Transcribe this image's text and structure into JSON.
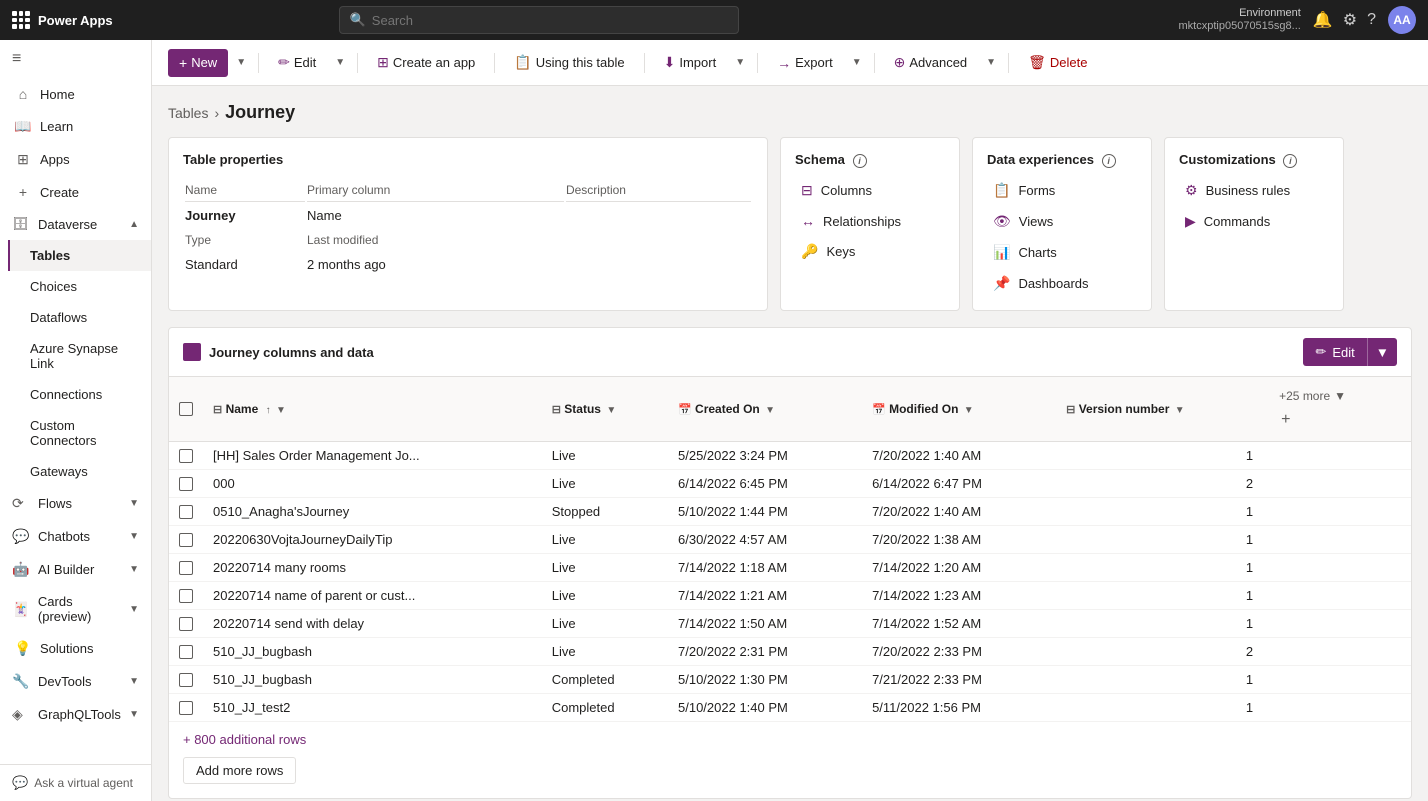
{
  "app": {
    "title": "Power Apps",
    "search_placeholder": "Search"
  },
  "env": {
    "label": "Environment",
    "name": "mktcxptip05070515sg8..."
  },
  "avatar": "AA",
  "sidebar": {
    "collapse_icon": "≡",
    "items": [
      {
        "id": "home",
        "label": "Home",
        "icon": "⌂"
      },
      {
        "id": "learn",
        "label": "Learn",
        "icon": "📖"
      },
      {
        "id": "apps",
        "label": "Apps",
        "icon": "⊞"
      },
      {
        "id": "create",
        "label": "Create",
        "icon": "+"
      },
      {
        "id": "dataverse",
        "label": "Dataverse",
        "icon": "🗄",
        "expandable": true,
        "expanded": true
      },
      {
        "id": "tables",
        "label": "Tables",
        "icon": ""
      },
      {
        "id": "choices",
        "label": "Choices",
        "icon": ""
      },
      {
        "id": "dataflows",
        "label": "Dataflows",
        "icon": ""
      },
      {
        "id": "azure-synapse",
        "label": "Azure Synapse Link",
        "icon": ""
      },
      {
        "id": "connections",
        "label": "Connections",
        "icon": ""
      },
      {
        "id": "custom-connectors",
        "label": "Custom Connectors",
        "icon": ""
      },
      {
        "id": "gateways",
        "label": "Gateways",
        "icon": ""
      },
      {
        "id": "flows",
        "label": "Flows",
        "icon": "⟳",
        "expandable": true
      },
      {
        "id": "chatbots",
        "label": "Chatbots",
        "icon": "💬",
        "expandable": true
      },
      {
        "id": "ai-builder",
        "label": "AI Builder",
        "icon": "🤖",
        "expandable": true
      },
      {
        "id": "cards",
        "label": "Cards (preview)",
        "icon": "🃏",
        "expandable": true
      },
      {
        "id": "solutions",
        "label": "Solutions",
        "icon": "💡"
      },
      {
        "id": "devtools",
        "label": "DevTools",
        "icon": "🔧",
        "expandable": true
      },
      {
        "id": "graphql-tools",
        "label": "GraphQLTools",
        "icon": "◈",
        "expandable": true
      }
    ],
    "virtual_agent": "Ask a virtual agent"
  },
  "toolbar": {
    "new_label": "New",
    "edit_label": "Edit",
    "create_app_label": "Create an app",
    "using_table_label": "Using this table",
    "import_label": "Import",
    "export_label": "Export",
    "advanced_label": "Advanced",
    "delete_label": "Delete"
  },
  "breadcrumb": {
    "tables_label": "Tables",
    "current": "Journey"
  },
  "table_properties": {
    "card_title": "Table properties",
    "cols": [
      "Name",
      "Primary column",
      "Description"
    ],
    "rows": [
      {
        "name": "Journey",
        "primary_column": "Name",
        "description": ""
      },
      {
        "type_label": "Type",
        "last_modified_label": "Last modified",
        "description": ""
      },
      {
        "name": "Standard",
        "primary_column": "2 months ago",
        "description": ""
      }
    ],
    "name_label": "Name",
    "type_label": "Type",
    "name_value": "Journey",
    "type_value": "Standard",
    "primary_col_label": "Primary column",
    "primary_col_value": "Name",
    "last_modified_label": "Last modified",
    "last_modified_value": "2 months ago",
    "description_label": "Description"
  },
  "schema": {
    "card_title": "Schema",
    "info": "i",
    "items": [
      {
        "id": "columns",
        "label": "Columns",
        "icon": "⊟"
      },
      {
        "id": "relationships",
        "label": "Relationships",
        "icon": "↔"
      },
      {
        "id": "keys",
        "label": "Keys",
        "icon": "🔑"
      }
    ]
  },
  "data_experiences": {
    "card_title": "Data experiences",
    "info": "i",
    "items": [
      {
        "id": "forms",
        "label": "Forms",
        "icon": "📋"
      },
      {
        "id": "views",
        "label": "Views",
        "icon": "👁"
      },
      {
        "id": "charts",
        "label": "Charts",
        "icon": "📊"
      },
      {
        "id": "dashboards",
        "label": "Dashboards",
        "icon": "📌"
      }
    ]
  },
  "customizations": {
    "card_title": "Customizations",
    "info": "i",
    "items": [
      {
        "id": "business-rules",
        "label": "Business rules",
        "icon": "⚙"
      },
      {
        "id": "commands",
        "label": "Commands",
        "icon": "▶"
      }
    ]
  },
  "data_table": {
    "section_title": "Journey columns and data",
    "edit_label": "Edit",
    "columns": [
      {
        "id": "name",
        "label": "Name",
        "icon": "⊟",
        "sortable": true,
        "filterable": true
      },
      {
        "id": "status",
        "label": "Status",
        "icon": "⊟",
        "sortable": false,
        "filterable": true
      },
      {
        "id": "created_on",
        "label": "Created On",
        "icon": "📅",
        "sortable": false,
        "filterable": true
      },
      {
        "id": "modified_on",
        "label": "Modified On",
        "icon": "📅",
        "sortable": false,
        "filterable": true
      },
      {
        "id": "version_number",
        "label": "Version number",
        "icon": "⊟",
        "sortable": false,
        "filterable": true
      }
    ],
    "more_cols_label": "+25 more",
    "rows": [
      {
        "name": "[HH] Sales Order Management Jo...",
        "status": "Live",
        "created_on": "5/25/2022 3:24 PM",
        "modified_on": "7/20/2022 1:40 AM",
        "version": "1"
      },
      {
        "name": "000",
        "status": "Live",
        "created_on": "6/14/2022 6:45 PM",
        "modified_on": "6/14/2022 6:47 PM",
        "version": "2"
      },
      {
        "name": "0510_Anagha'sJourney",
        "status": "Stopped",
        "created_on": "5/10/2022 1:44 PM",
        "modified_on": "7/20/2022 1:40 AM",
        "version": "1"
      },
      {
        "name": "20220630VojtaJourneyDailyTip",
        "status": "Live",
        "created_on": "6/30/2022 4:57 AM",
        "modified_on": "7/20/2022 1:38 AM",
        "version": "1"
      },
      {
        "name": "20220714 many rooms",
        "status": "Live",
        "created_on": "7/14/2022 1:18 AM",
        "modified_on": "7/14/2022 1:20 AM",
        "version": "1"
      },
      {
        "name": "20220714 name of parent or cust...",
        "status": "Live",
        "created_on": "7/14/2022 1:21 AM",
        "modified_on": "7/14/2022 1:23 AM",
        "version": "1"
      },
      {
        "name": "20220714 send with delay",
        "status": "Live",
        "created_on": "7/14/2022 1:50 AM",
        "modified_on": "7/14/2022 1:52 AM",
        "version": "1"
      },
      {
        "name": "510_JJ_bugbash",
        "status": "Live",
        "created_on": "7/20/2022 2:31 PM",
        "modified_on": "7/20/2022 2:33 PM",
        "version": "2"
      },
      {
        "name": "510_JJ_bugbash",
        "status": "Completed",
        "created_on": "5/10/2022 1:30 PM",
        "modified_on": "7/21/2022 2:33 PM",
        "version": "1"
      },
      {
        "name": "510_JJ_test2",
        "status": "Completed",
        "created_on": "5/10/2022 1:40 PM",
        "modified_on": "5/11/2022 1:56 PM",
        "version": "1"
      }
    ],
    "more_rows_label": "+ 800 additional rows",
    "add_more_rows_label": "Add more rows"
  }
}
